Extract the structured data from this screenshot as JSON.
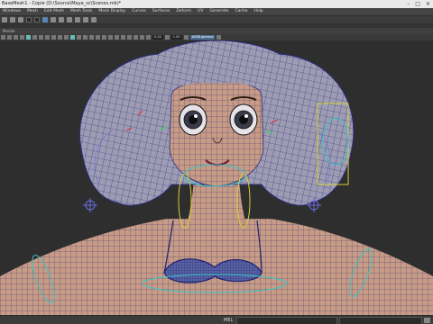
{
  "window": {
    "title": "BaseMesh1 - Copie (D:\\Source\\Maya_sc\\Scenes.mb)*",
    "buttons": [
      "minimize-icon",
      "maximize-icon",
      "close-icon"
    ]
  },
  "menu": [
    "Windows",
    "Mesh",
    "Edit Mesh",
    "Mesh Tools",
    "Mesh Display",
    "Curves",
    "Surfaces",
    "Deform",
    "UV",
    "Generate",
    "Cache",
    "Help"
  ],
  "panel": {
    "menu_label": "Persim",
    "field_a": "0.00",
    "field_b": "1.00",
    "colorspace": "sRGB gamma"
  },
  "commandline": {
    "language": "MEL"
  },
  "colors": {
    "mesh_skin": "#c8a08a",
    "wire": "#2a2f7a",
    "hair_grey": "#b8b5c8",
    "control_cyan": "#36c6c6",
    "control_yellow": "#d7cf36",
    "control_blue": "#6a6fe0"
  }
}
